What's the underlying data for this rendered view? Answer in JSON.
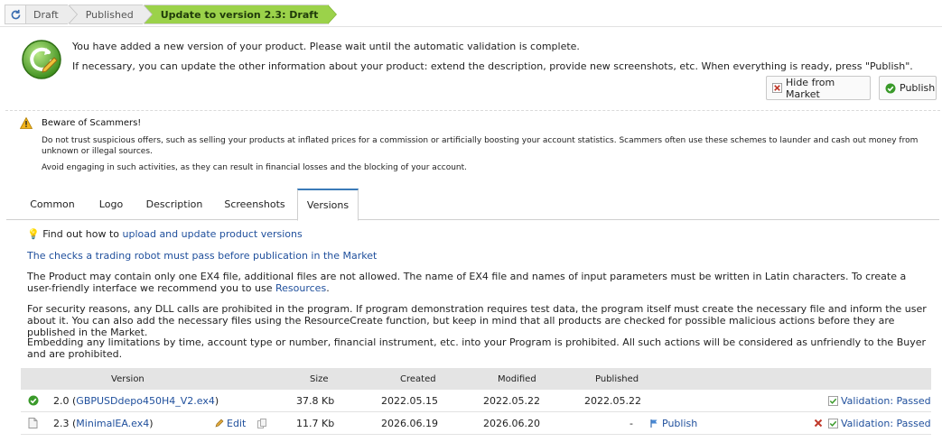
{
  "breadcrumbs": [
    "Draft",
    "Published",
    "Update to version 2.3: Draft"
  ],
  "info": {
    "line1": "You have added a new version of your product. Please wait until the automatic validation is complete.",
    "line2": "If necessary, you can update the other information about your product: extend the description, provide new screenshots, etc. When everything is ready, press \"Publish\".",
    "hide_label": "Hide from Market",
    "publish_label": "Publish"
  },
  "warning": {
    "title": "Beware of Scammers!",
    "p1": "Do not trust suspicious offers, such as selling your products at inflated prices for a commission or artificially boosting your account statistics. Scammers often use these schemes to launder and cash out money from unknown or illegal sources.",
    "p2": "Avoid engaging in such activities, as they can result in financial losses and the blocking of your account."
  },
  "tabs": [
    "Common",
    "Logo",
    "Description",
    "Screenshots",
    "Versions"
  ],
  "active_tab": "Versions",
  "content": {
    "find_prefix": "Find out how to ",
    "find_link": "upload and update product versions",
    "checks_link": "The checks a trading robot must pass before publication in the Market",
    "p1": "The Product may contain only one EX4 file, additional files are not allowed. The name of EX4 file and names of input parameters must be written in Latin characters. To create a user-friendly interface we recommend you to use ",
    "p1_link": "Resources",
    "p1_end": ".",
    "p2": "For security reasons, any DLL calls are prohibited in the program. If program demonstration requires test data, the program itself must create the necessary file and inform the user about it. You can also add the necessary files using the ResourceCreate function, but keep in mind that all products are checked for possible malicious actions before they are published in the Market.",
    "p3": "Embedding any limitations by time, account type or number, financial instrument, etc. into your Program is prohibited. All such actions will be considered as unfriendly to the Buyer and are prohibited."
  },
  "table": {
    "headers": {
      "version": "Version",
      "size": "Size",
      "created": "Created",
      "modified": "Modified",
      "published": "Published"
    },
    "rows": [
      {
        "version": "2.0",
        "file": "GBPUSDdepo450H4_V2.ex4",
        "size": "37.8 Kb",
        "created": "2022.05.15",
        "modified": "2022.05.22",
        "published": "2022.05.22",
        "validation": "Validation: Passed"
      },
      {
        "version": "2.3",
        "file": "MinimalEA.ex4",
        "edit_label": "Edit",
        "size": "11.7 Kb",
        "created": "2026.06.19",
        "modified": "2026.06.20",
        "published": "-",
        "publish_label": "Publish",
        "validation": "Validation: Passed"
      }
    ]
  }
}
